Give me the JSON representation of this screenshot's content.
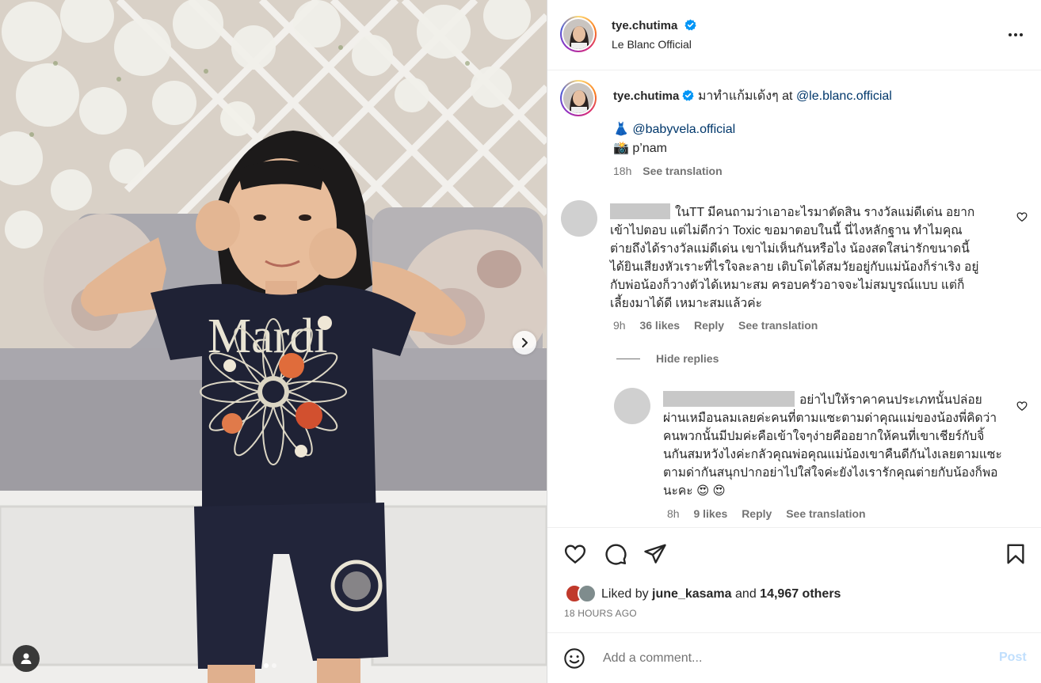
{
  "post": {
    "author": "tye.chutima",
    "location": "Le Blanc Official"
  },
  "caption": {
    "author": "tye.chutima",
    "text": "มาทำแก้มเด้งๆ at",
    "mention_venue": "@le.blanc.official",
    "dress_emoji": "👗",
    "mention_dress": "@babyvela.official",
    "camera_emoji": "📸",
    "photographer": "p’nam",
    "time": "18h",
    "see_translation": "See translation"
  },
  "comments": [
    {
      "text": "ในTT มีคนถามว่าเอาอะไรมาตัดสิน รางวัลแม่ดีเด่น อยากเข้าไปตอบ แต่ไม่ดีกว่า Toxic ขอมาตอบในนี้ นี่ไงหลักฐาน ทำไมคุณต่ายถึงได้รางวัลแม่ดีเด่น เขาไม่เห็นกันหรือไง น้องสดใสน่ารักขนาดนี้ ได้ยินเสียงหัวเราะที่ไรใจละลาย เติบโตได้สมวัยอยู่กับแม่น้องก็ร่าเริง อยู่กับพ่อน้องก็วางตัวได้เหมาะสม ครอบครัวอาจจะไม่สมบูรณ์แบบ แต่ก็เลี้ยงมาได้ดี เหมาะสมแล้วค่ะ",
      "time": "9h",
      "likes": "36 likes",
      "reply": "Reply",
      "see_translation": "See translation"
    },
    {
      "text": "อย่าไปให้ราคาคนประเภทนั้นปล่อยผ่านเหมือนลมเลยค่ะคนที่ตามแซะตามด่าคุณแม่ของน้องพี่คิดว่าคนพวกนั้นมีปมค่ะคือเข้าใจๆง่ายคืออยากให้คนที่เขาเชียร์กับจิ้นกันสมหวังไงค่ะกลัวคุณพ่อคุณแม่น้องเขาคืนดีกันไงเลยตามแซะตามด่ากันสนุกปากอย่าไปใส่ใจค่ะยังไงเรารักคุณต่ายกับน้องก็พอนะคะ",
      "emoji": "😍 😍",
      "time": "8h",
      "likes": "9 likes",
      "reply": "Reply",
      "see_translation": "See translation"
    }
  ],
  "hide_replies": "Hide replies",
  "likes_summary": {
    "prefix": "Liked by",
    "user": "june_kasama",
    "middle": "and",
    "others": "14,967 others"
  },
  "posted_ago": "18 HOURS AGO",
  "add_comment": {
    "placeholder": "Add a comment...",
    "post_label": "Post"
  },
  "media": {
    "shirt_text": "Mardi",
    "dots_total": 2,
    "active_dot": 1
  },
  "colors": {
    "link": "#00376b",
    "muted": "#737373",
    "verified": "#0095f6",
    "post_disabled": "#c0dffd",
    "shirt": "#1f2235"
  },
  "icons": [
    "verified-badge-icon",
    "more-options-icon",
    "heart-icon",
    "comment-icon",
    "share-icon",
    "save-icon",
    "emoji-icon",
    "chevron-right-icon",
    "user-tag-icon"
  ]
}
